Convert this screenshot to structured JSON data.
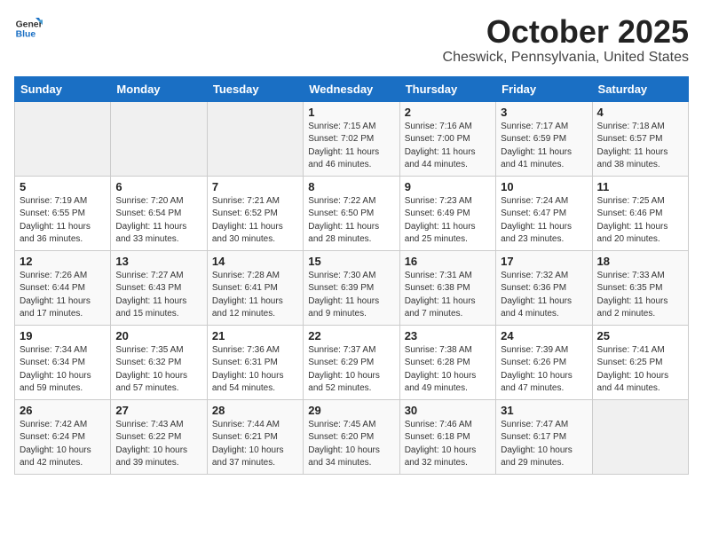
{
  "logo": {
    "text_general": "General",
    "text_blue": "Blue"
  },
  "title": "October 2025",
  "subtitle": "Cheswick, Pennsylvania, United States",
  "days_of_week": [
    "Sunday",
    "Monday",
    "Tuesday",
    "Wednesday",
    "Thursday",
    "Friday",
    "Saturday"
  ],
  "weeks": [
    [
      {
        "day": "",
        "info": ""
      },
      {
        "day": "",
        "info": ""
      },
      {
        "day": "",
        "info": ""
      },
      {
        "day": "1",
        "info": "Sunrise: 7:15 AM\nSunset: 7:02 PM\nDaylight: 11 hours\nand 46 minutes."
      },
      {
        "day": "2",
        "info": "Sunrise: 7:16 AM\nSunset: 7:00 PM\nDaylight: 11 hours\nand 44 minutes."
      },
      {
        "day": "3",
        "info": "Sunrise: 7:17 AM\nSunset: 6:59 PM\nDaylight: 11 hours\nand 41 minutes."
      },
      {
        "day": "4",
        "info": "Sunrise: 7:18 AM\nSunset: 6:57 PM\nDaylight: 11 hours\nand 38 minutes."
      }
    ],
    [
      {
        "day": "5",
        "info": "Sunrise: 7:19 AM\nSunset: 6:55 PM\nDaylight: 11 hours\nand 36 minutes."
      },
      {
        "day": "6",
        "info": "Sunrise: 7:20 AM\nSunset: 6:54 PM\nDaylight: 11 hours\nand 33 minutes."
      },
      {
        "day": "7",
        "info": "Sunrise: 7:21 AM\nSunset: 6:52 PM\nDaylight: 11 hours\nand 30 minutes."
      },
      {
        "day": "8",
        "info": "Sunrise: 7:22 AM\nSunset: 6:50 PM\nDaylight: 11 hours\nand 28 minutes."
      },
      {
        "day": "9",
        "info": "Sunrise: 7:23 AM\nSunset: 6:49 PM\nDaylight: 11 hours\nand 25 minutes."
      },
      {
        "day": "10",
        "info": "Sunrise: 7:24 AM\nSunset: 6:47 PM\nDaylight: 11 hours\nand 23 minutes."
      },
      {
        "day": "11",
        "info": "Sunrise: 7:25 AM\nSunset: 6:46 PM\nDaylight: 11 hours\nand 20 minutes."
      }
    ],
    [
      {
        "day": "12",
        "info": "Sunrise: 7:26 AM\nSunset: 6:44 PM\nDaylight: 11 hours\nand 17 minutes."
      },
      {
        "day": "13",
        "info": "Sunrise: 7:27 AM\nSunset: 6:43 PM\nDaylight: 11 hours\nand 15 minutes."
      },
      {
        "day": "14",
        "info": "Sunrise: 7:28 AM\nSunset: 6:41 PM\nDaylight: 11 hours\nand 12 minutes."
      },
      {
        "day": "15",
        "info": "Sunrise: 7:30 AM\nSunset: 6:39 PM\nDaylight: 11 hours\nand 9 minutes."
      },
      {
        "day": "16",
        "info": "Sunrise: 7:31 AM\nSunset: 6:38 PM\nDaylight: 11 hours\nand 7 minutes."
      },
      {
        "day": "17",
        "info": "Sunrise: 7:32 AM\nSunset: 6:36 PM\nDaylight: 11 hours\nand 4 minutes."
      },
      {
        "day": "18",
        "info": "Sunrise: 7:33 AM\nSunset: 6:35 PM\nDaylight: 11 hours\nand 2 minutes."
      }
    ],
    [
      {
        "day": "19",
        "info": "Sunrise: 7:34 AM\nSunset: 6:34 PM\nDaylight: 10 hours\nand 59 minutes."
      },
      {
        "day": "20",
        "info": "Sunrise: 7:35 AM\nSunset: 6:32 PM\nDaylight: 10 hours\nand 57 minutes."
      },
      {
        "day": "21",
        "info": "Sunrise: 7:36 AM\nSunset: 6:31 PM\nDaylight: 10 hours\nand 54 minutes."
      },
      {
        "day": "22",
        "info": "Sunrise: 7:37 AM\nSunset: 6:29 PM\nDaylight: 10 hours\nand 52 minutes."
      },
      {
        "day": "23",
        "info": "Sunrise: 7:38 AM\nSunset: 6:28 PM\nDaylight: 10 hours\nand 49 minutes."
      },
      {
        "day": "24",
        "info": "Sunrise: 7:39 AM\nSunset: 6:26 PM\nDaylight: 10 hours\nand 47 minutes."
      },
      {
        "day": "25",
        "info": "Sunrise: 7:41 AM\nSunset: 6:25 PM\nDaylight: 10 hours\nand 44 minutes."
      }
    ],
    [
      {
        "day": "26",
        "info": "Sunrise: 7:42 AM\nSunset: 6:24 PM\nDaylight: 10 hours\nand 42 minutes."
      },
      {
        "day": "27",
        "info": "Sunrise: 7:43 AM\nSunset: 6:22 PM\nDaylight: 10 hours\nand 39 minutes."
      },
      {
        "day": "28",
        "info": "Sunrise: 7:44 AM\nSunset: 6:21 PM\nDaylight: 10 hours\nand 37 minutes."
      },
      {
        "day": "29",
        "info": "Sunrise: 7:45 AM\nSunset: 6:20 PM\nDaylight: 10 hours\nand 34 minutes."
      },
      {
        "day": "30",
        "info": "Sunrise: 7:46 AM\nSunset: 6:18 PM\nDaylight: 10 hours\nand 32 minutes."
      },
      {
        "day": "31",
        "info": "Sunrise: 7:47 AM\nSunset: 6:17 PM\nDaylight: 10 hours\nand 29 minutes."
      },
      {
        "day": "",
        "info": ""
      }
    ]
  ]
}
